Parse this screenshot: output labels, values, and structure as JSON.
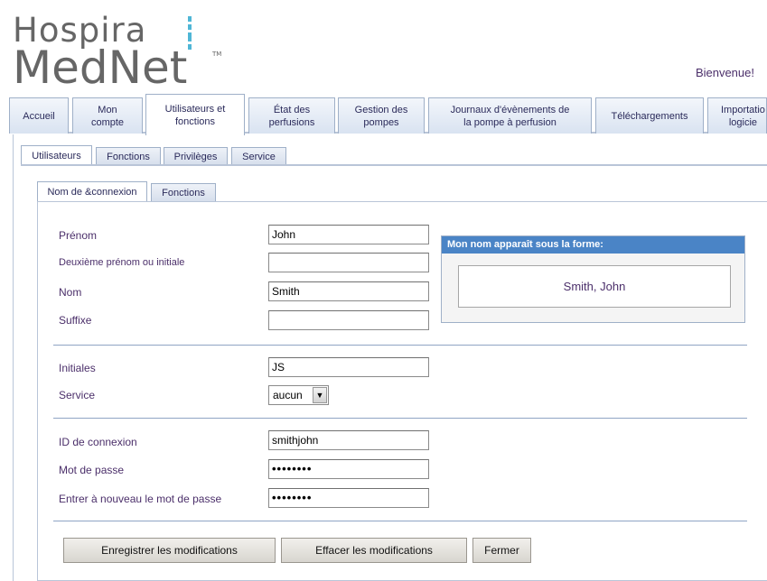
{
  "brand": {
    "line1": "Hospira",
    "line2": "MedNet",
    "tm": "TM"
  },
  "welcome": "Bienvenue!",
  "main_tabs": [
    {
      "label": "Accueil"
    },
    {
      "label": "Mon\ncompte"
    },
    {
      "label": "Utilisateurs et\nfonctions"
    },
    {
      "label": "État des\nperfusions"
    },
    {
      "label": "Gestion des\npompes"
    },
    {
      "label": "Journaux d'évènements de\nla pompe à perfusion"
    },
    {
      "label": "Téléchargements"
    },
    {
      "label": "Importatio\nlogicie"
    }
  ],
  "sub_tabs": [
    {
      "label": "Utilisateurs"
    },
    {
      "label": "Fonctions"
    },
    {
      "label": "Privilèges"
    },
    {
      "label": "Service"
    }
  ],
  "inner_tabs": [
    {
      "label": "Nom de &connexion"
    },
    {
      "label": "Fonctions"
    }
  ],
  "form": {
    "prenom": {
      "label": "Prénom",
      "value": "John"
    },
    "deuxieme": {
      "label": "Deuxième prénom ou initiale",
      "value": ""
    },
    "nom": {
      "label": "Nom",
      "value": "Smith"
    },
    "suffixe": {
      "label": "Suffixe",
      "value": ""
    },
    "initiales": {
      "label": "Initiales",
      "value": "JS"
    },
    "service": {
      "label": "Service",
      "value": "aucun"
    },
    "login_id": {
      "label": "ID de connexion",
      "value": "smithjohn"
    },
    "password": {
      "label": "Mot de passe",
      "value": "••••••••"
    },
    "password_confirm": {
      "label": "Entrer à nouveau le mot de passe",
      "value": "••••••••"
    }
  },
  "display_name": {
    "header": "Mon nom apparaît sous la forme:",
    "value": "Smith, John"
  },
  "buttons": {
    "save": "Enregistrer les modifications",
    "clear": "Effacer les modifications",
    "close": "Fermer"
  },
  "colors": {
    "label": "#4b2f6a",
    "accent": "#4a84c6",
    "logo_mark": "#4fb6d6"
  }
}
